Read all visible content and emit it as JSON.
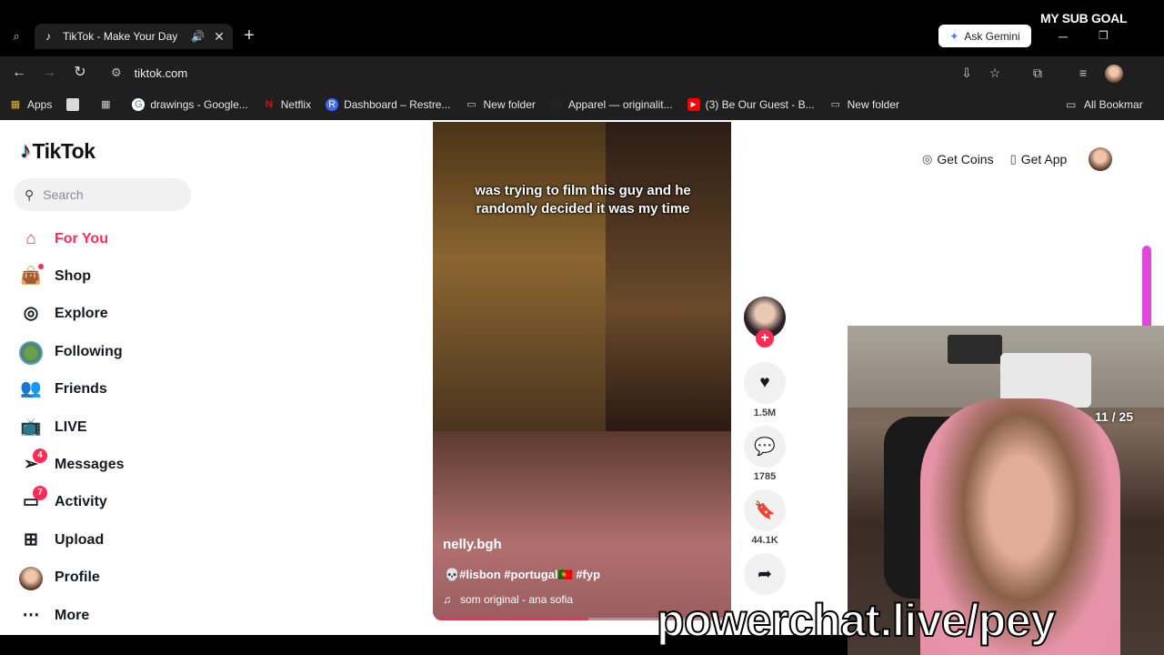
{
  "browser": {
    "tab": {
      "title": "TikTok - Make Your Day",
      "favicon": "tiktok-icon",
      "audio_icon": "speaker-icon"
    },
    "ask_gemini_label": "Ask Gemini",
    "stream_overlay_goal": "MY SUB GOAL",
    "url": "tiktok.com",
    "bookmarks": [
      {
        "label": "Apps",
        "icon": "apps-grid-icon",
        "color": "#f2b233"
      },
      {
        "label": "drawings - Google...",
        "icon": "google-icon",
        "color": "#4285f4"
      },
      {
        "label": "Netflix",
        "icon": "netflix-icon",
        "color": "#e50914"
      },
      {
        "label": "Dashboard – Restre...",
        "icon": "restream-icon",
        "color": "#3f67ff"
      },
      {
        "label": "New folder",
        "icon": "folder-icon",
        "color": "#cccccc"
      },
      {
        "label": "Apparel — originalit...",
        "icon": "site-icon",
        "color": "#222222"
      },
      {
        "label": "(3) Be Our Guest - B...",
        "icon": "youtube-icon",
        "color": "#ff0000"
      },
      {
        "label": "New folder",
        "icon": "folder-icon",
        "color": "#cccccc"
      }
    ],
    "all_bookmarks_label": "All Bookmar"
  },
  "tiktok": {
    "logo_text": "TikTok",
    "search_placeholder": "Search",
    "menu": [
      {
        "label": "For You",
        "icon": "home-icon",
        "active": true
      },
      {
        "label": "Shop",
        "icon": "shopping-bag-icon",
        "dot": true
      },
      {
        "label": "Explore",
        "icon": "compass-icon"
      },
      {
        "label": "Following",
        "icon": "following-avatar"
      },
      {
        "label": "Friends",
        "icon": "friends-icon"
      },
      {
        "label": "LIVE",
        "icon": "live-tv-icon"
      },
      {
        "label": "Messages",
        "icon": "send-icon",
        "badge": "4"
      },
      {
        "label": "Activity",
        "icon": "activity-icon",
        "badge": "7"
      },
      {
        "label": "Upload",
        "icon": "plus-square-icon"
      },
      {
        "label": "Profile",
        "icon": "profile-avatar"
      },
      {
        "label": "More",
        "icon": "more-dots-icon"
      }
    ],
    "video": {
      "caption": "was trying to film this guy and he randomly decided it was my time",
      "author": "nelly.bgh",
      "description": "💀#lisbon #portugal🇵🇹 #fyp",
      "music": "som original - ana sofia",
      "progress": 0.52
    },
    "actions": {
      "likes": "1.5M",
      "comments": "1785",
      "saves": "44.1K"
    },
    "top_right": {
      "get_coins": "Get Coins",
      "get_app": "Get App"
    }
  },
  "overlay": {
    "counter": "11 / 25",
    "watermark": "powerchat.live/pey"
  }
}
